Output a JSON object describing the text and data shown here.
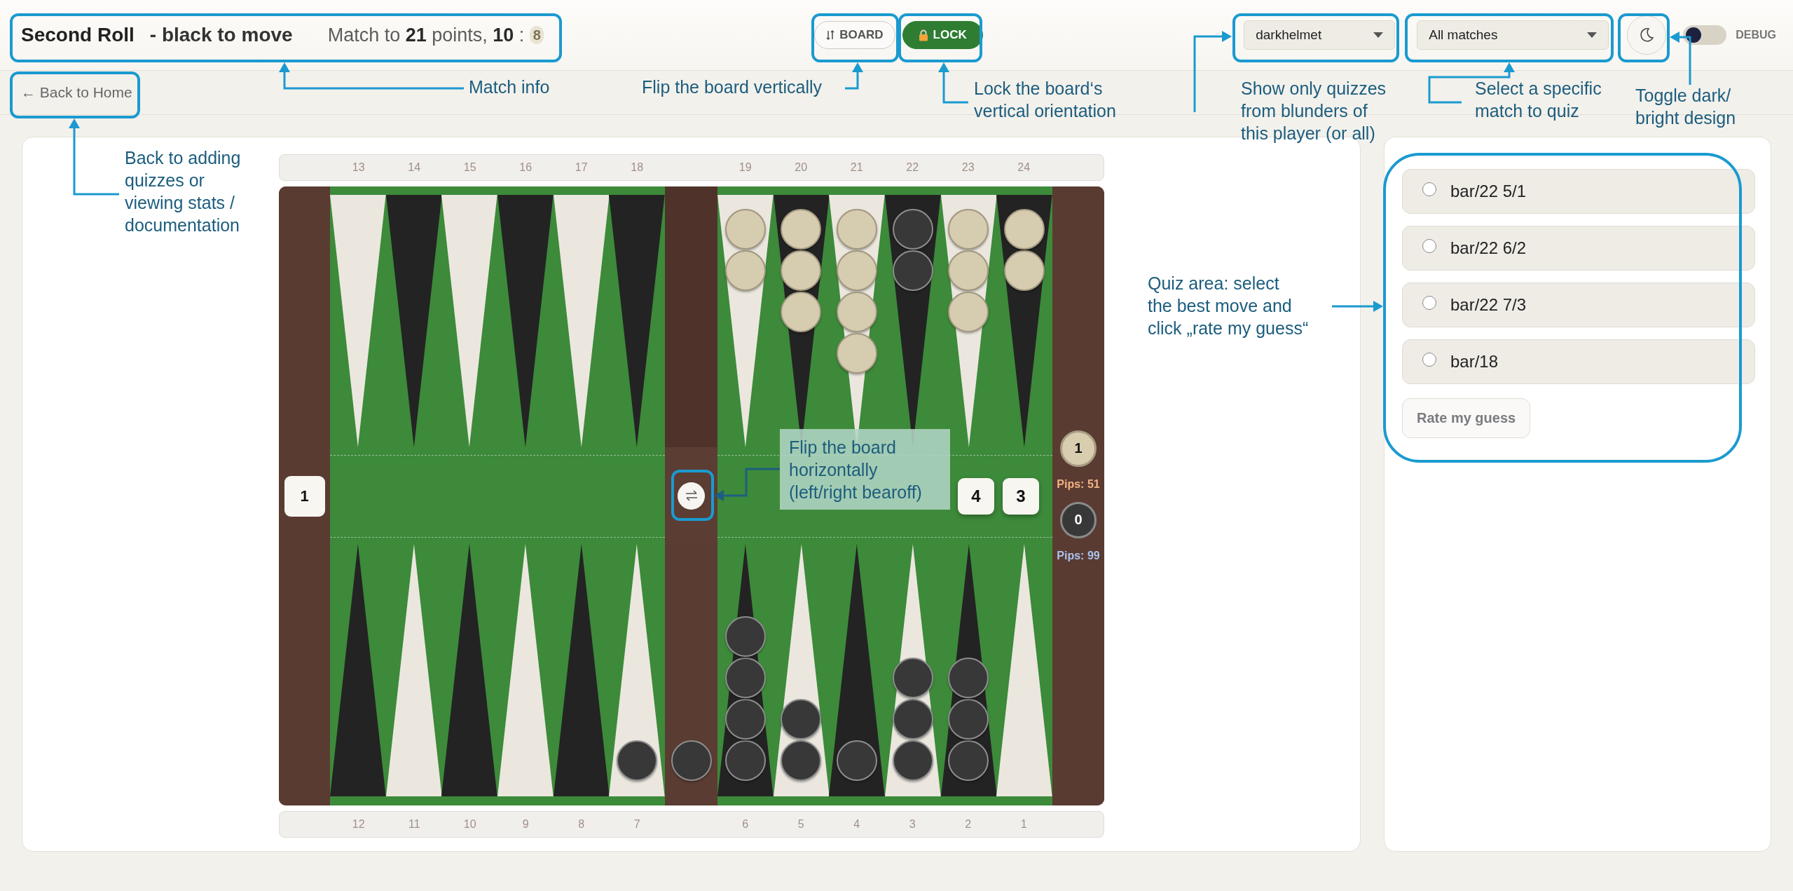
{
  "header": {
    "title": "Second Roll",
    "subtitle": "- black to move",
    "match_info": "Match to **21** points, **10** :",
    "opponent_score": "8",
    "buttons": [
      {
        "kind": "flip",
        "label": "BOARD",
        "active": false
      },
      {
        "kind": "lock",
        "label": "LOCK",
        "active": true
      }
    ],
    "player_filter": {
      "value": "darkhelmet"
    },
    "match_filter": {
      "value": "All matches"
    },
    "debug_toggle": {
      "label": "DEBUG",
      "on": false
    }
  },
  "nav": {
    "back_link": "← Back to Home"
  },
  "board": {
    "top_points": [
      {
        "label": "13"
      },
      {
        "label": "14"
      },
      {
        "label": "15"
      },
      {
        "label": "16"
      },
      {
        "label": "17"
      },
      {
        "label": "18"
      },
      {
        "label": "19",
        "checkers": [
          {
            "kind": "light"
          },
          {
            "kind": "light"
          }
        ]
      },
      {
        "label": "20",
        "checkers": [
          {
            "kind": "light"
          },
          {
            "kind": "light"
          },
          {
            "kind": "light"
          }
        ]
      },
      {
        "label": "21",
        "checkers": [
          {
            "kind": "light"
          },
          {
            "kind": "light"
          },
          {
            "kind": "light"
          },
          {
            "kind": "light"
          }
        ]
      },
      {
        "label": "22",
        "checkers": [
          {
            "kind": "dark"
          },
          {
            "kind": "dark"
          }
        ]
      },
      {
        "label": "23",
        "checkers": [
          {
            "kind": "light"
          },
          {
            "kind": "light"
          },
          {
            "kind": "light"
          }
        ]
      },
      {
        "label": "24",
        "checkers": [
          {
            "kind": "light"
          },
          {
            "kind": "light"
          }
        ]
      }
    ],
    "bottom_points": [
      {
        "label": "12"
      },
      {
        "label": "11"
      },
      {
        "label": "10"
      },
      {
        "label": "9"
      },
      {
        "label": "8"
      },
      {
        "label": "7",
        "checkers": [
          {
            "kind": "dark"
          }
        ]
      },
      {
        "label": "6",
        "checkers": [
          {
            "kind": "dark"
          },
          {
            "kind": "dark"
          },
          {
            "kind": "dark"
          },
          {
            "kind": "dark"
          }
        ]
      },
      {
        "label": "5",
        "checkers": [
          {
            "kind": "dark"
          },
          {
            "kind": "dark"
          }
        ]
      },
      {
        "label": "4",
        "checkers": [
          {
            "kind": "dark"
          }
        ]
      },
      {
        "label": "3",
        "checkers": [
          {
            "kind": "dark"
          },
          {
            "kind": "dark"
          },
          {
            "kind": "dark"
          }
        ]
      },
      {
        "label": "2",
        "checkers": [
          {
            "kind": "dark"
          },
          {
            "kind": "dark"
          },
          {
            "kind": "dark"
          }
        ]
      },
      {
        "label": "1"
      }
    ],
    "bar_checkers": [
      {
        "kind": "dark"
      }
    ],
    "cube": "1",
    "dice": [
      "4",
      "3"
    ],
    "light_off": "1",
    "light_pips": "Pips: 51",
    "dark_off": "0",
    "dark_pips": "Pips: 99"
  },
  "quiz": {
    "options": [
      {
        "label": "bar/22 5/1",
        "selected": false
      },
      {
        "label": "bar/22 6/2",
        "selected": false
      },
      {
        "label": "bar/22 7/3",
        "selected": false
      },
      {
        "label": "bar/18",
        "selected": false
      }
    ],
    "rate_button": {
      "label": "Rate my guess",
      "disabled": true
    }
  },
  "annotations": [
    {
      "kind": "plain",
      "text": "Match info"
    },
    {
      "kind": "plain",
      "text": "Flip the board vertically"
    },
    {
      "kind": "plain",
      "text": "Lock the board‘s\nvertical orientation"
    },
    {
      "kind": "plain",
      "text": "Show only quizzes\nfrom blunders of\nthis player (or all)"
    },
    {
      "kind": "plain",
      "text": "Select a specific\nmatch to quiz"
    },
    {
      "kind": "plain",
      "text": "Toggle dark/\nbright design"
    },
    {
      "kind": "plain",
      "text": "Back to adding\nquizzes or\nviewing stats /\ndocumentation"
    },
    {
      "kind": "boxed",
      "text": "Flip the board\nhorizontally\n(left/right bearoff)"
    },
    {
      "kind": "plain",
      "text": "Quiz area: select\nthe best move and\nclick „rate my guess“"
    }
  ]
}
